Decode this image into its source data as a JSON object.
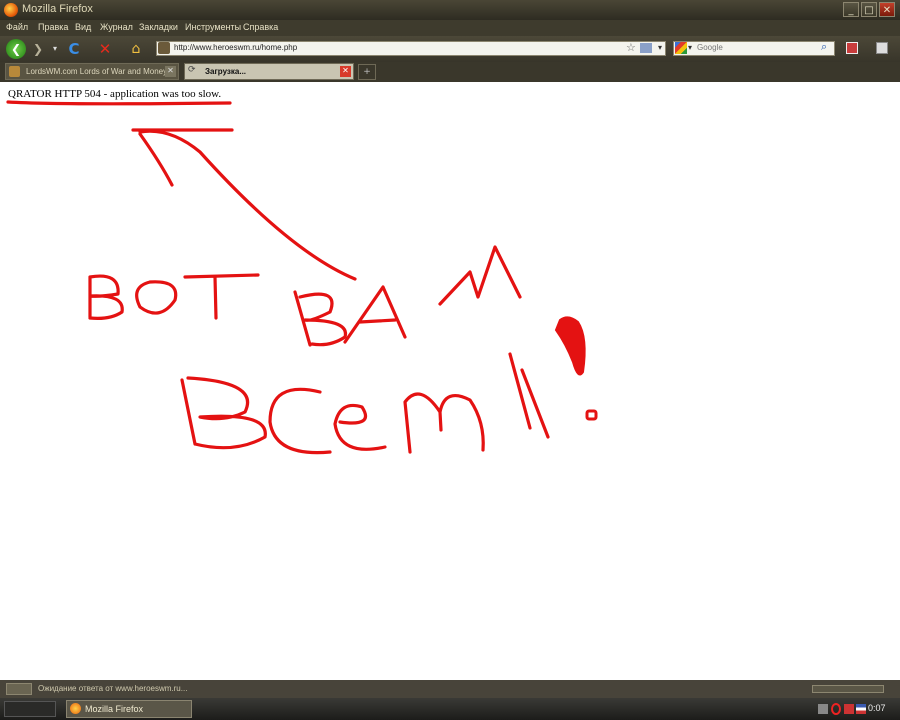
{
  "window": {
    "title": "Mozilla Firefox",
    "min": "_",
    "max": "□",
    "close": "✕"
  },
  "menu": [
    "Файл",
    "Правка",
    "Вид",
    "Журнал",
    "Закладки",
    "Инструменты",
    "Справка"
  ],
  "nav": {
    "url": "http://www.heroeswm.ru/home.php",
    "search_placeholder": "Google"
  },
  "tabs": [
    {
      "label": "LordsWM.com Lords of War and Money..."
    },
    {
      "label": "Загрузка..."
    }
  ],
  "page": {
    "error": "QRATOR HTTP 504 - application was too slow.",
    "handwriting_line1": "ВОТ ВАМ",
    "handwriting_line2": "ВСЕМ!"
  },
  "status": {
    "text": "Ожидание ответа от www.heroeswm.ru..."
  },
  "taskbar": {
    "app": "Mozilla Firefox",
    "clock": "0:07"
  },
  "colors": {
    "scribble": "#e41212",
    "content_bg": "#ffffff",
    "chrome": "#3e3b2d"
  }
}
